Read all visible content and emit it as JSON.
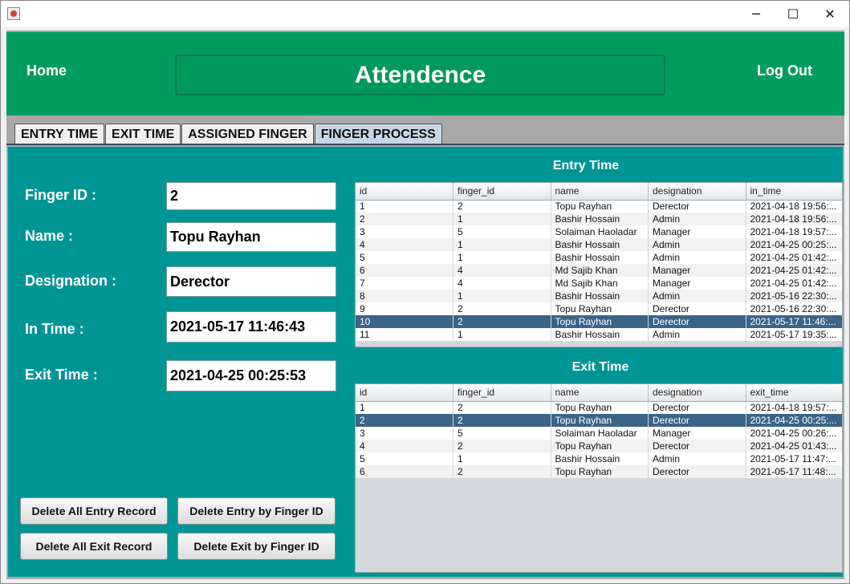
{
  "window": {
    "controls": {
      "minimize": "─",
      "maximize": "☐",
      "close": "✕"
    }
  },
  "header": {
    "home": "Home",
    "title": "Attendence",
    "logout": "Log Out"
  },
  "tabs": [
    {
      "label": "ENTRY TIME"
    },
    {
      "label": "EXIT TIME"
    },
    {
      "label": "ASSIGNED FINGER"
    },
    {
      "label": "FINGER PROCESS"
    }
  ],
  "form": {
    "finger_id_label": "Finger ID :",
    "finger_id_value": "2",
    "name_label": "Name :",
    "name_value": "Topu Rayhan",
    "designation_label": "Designation :",
    "designation_value": "Derector",
    "in_time_label": "In Time :",
    "in_time_value": "2021-05-17 11:46:43",
    "exit_time_label": "Exit Time :",
    "exit_time_value": "2021-04-25 00:25:53"
  },
  "buttons": {
    "delete_all_entry": "Delete All Entry Record",
    "delete_entry_by_id": "Delete Entry by Finger ID",
    "delete_all_exit": "Delete All Exit Record",
    "delete_exit_by_id": "Delete Exit by Finger ID"
  },
  "entry_table": {
    "title": "Entry Time",
    "columns": [
      "id",
      "finger_id",
      "name",
      "designation",
      "in_time"
    ],
    "rows": [
      [
        "1",
        "2",
        "Topu Rayhan",
        "Derector",
        "2021-04-18 19:56:..."
      ],
      [
        "2",
        "1",
        "Bashir Hossain",
        "Admin",
        "2021-04-18 19:56:..."
      ],
      [
        "3",
        "5",
        "Solaiman Haoladar",
        "Manager",
        "2021-04-18 19:57:..."
      ],
      [
        "4",
        "1",
        "Bashir Hossain",
        "Admin",
        "2021-04-25 00:25:..."
      ],
      [
        "5",
        "1",
        "Bashir Hossain",
        "Admin",
        "2021-04-25 01:42:..."
      ],
      [
        "6",
        "4",
        "Md Sajib Khan",
        "Manager",
        "2021-04-25 01:42:..."
      ],
      [
        "7",
        "4",
        "Md Sajib Khan",
        "Manager",
        "2021-04-25 01:42:..."
      ],
      [
        "8",
        "1",
        "Bashir Hossain",
        "Admin",
        "2021-05-16 22:30:..."
      ],
      [
        "9",
        "2",
        "Topu Rayhan",
        "Derector",
        "2021-05-16 22:30:..."
      ],
      [
        "10",
        "2",
        "Topu Rayhan",
        "Derector",
        "2021-05-17 11:46:..."
      ],
      [
        "11",
        "1",
        "Bashir Hossain",
        "Admin",
        "2021-05-17 19:35:..."
      ]
    ],
    "selected_row": 9
  },
  "exit_table": {
    "title": "Exit Time",
    "columns": [
      "id",
      "finger_id",
      "name",
      "designation",
      "exit_time"
    ],
    "rows": [
      [
        "1",
        "2",
        "Topu Rayhan",
        "Derector",
        "2021-04-18 19:57:..."
      ],
      [
        "2",
        "2",
        "Topu Rayhan",
        "Derector",
        "2021-04-25 00:25:..."
      ],
      [
        "3",
        "5",
        "Solaiman Haoladar",
        "Manager",
        "2021-04-25 00:26:..."
      ],
      [
        "4",
        "2",
        "Topu Rayhan",
        "Derector",
        "2021-04-25 01:43:..."
      ],
      [
        "5",
        "1",
        "Bashir Hossain",
        "Admin",
        "2021-05-17 11:47:..."
      ],
      [
        "6",
        "2",
        "Topu Rayhan",
        "Derector",
        "2021-05-17 11:48:..."
      ]
    ],
    "selected_row": 1
  },
  "colors": {
    "header_bg": "#009c5f",
    "panel_bg": "#009595",
    "selection": "#3a6488"
  }
}
